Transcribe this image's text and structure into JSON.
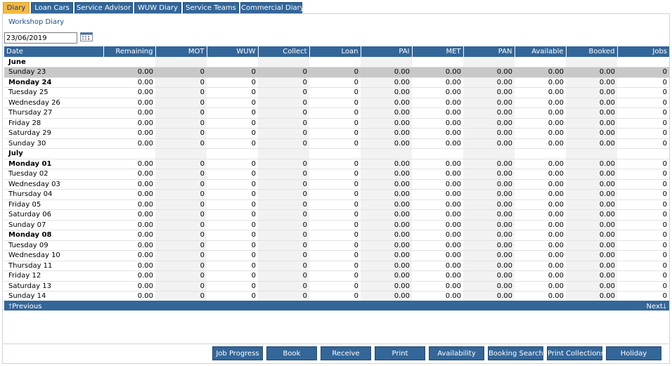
{
  "tabs": [
    {
      "label": "Diary",
      "active": true
    },
    {
      "label": "Loan Cars",
      "active": false
    },
    {
      "label": "Service Advisor",
      "active": false
    },
    {
      "label": "WUW Diary",
      "active": false
    },
    {
      "label": "Service Teams",
      "active": false
    },
    {
      "label": "Commercial Diary",
      "active": false
    }
  ],
  "page_title": "Workshop Diary",
  "date_input": {
    "value": "23/06/2019"
  },
  "columns": [
    "Date",
    "Remaining",
    "MOT",
    "WUW",
    "Collect",
    "Loan",
    "PAI",
    "MET",
    "PAN",
    "Available",
    "Booked",
    "Jobs"
  ],
  "rows": [
    {
      "kind": "month",
      "label": "June"
    },
    {
      "kind": "day",
      "label": "Sunday 23",
      "selected": true,
      "values": [
        "0.00",
        "0",
        "0",
        "0",
        "0",
        "0.00",
        "0.00",
        "0.00",
        "0.00",
        "0.00",
        "0"
      ]
    },
    {
      "kind": "day",
      "label": "Monday 24",
      "bold": true,
      "values": [
        "0.00",
        "0",
        "0",
        "0",
        "0",
        "0.00",
        "0.00",
        "0.00",
        "0.00",
        "0.00",
        "0"
      ]
    },
    {
      "kind": "day",
      "label": "Tuesday 25",
      "values": [
        "0.00",
        "0",
        "0",
        "0",
        "0",
        "0.00",
        "0.00",
        "0.00",
        "0.00",
        "0.00",
        "0"
      ]
    },
    {
      "kind": "day",
      "label": "Wednesday 26",
      "values": [
        "0.00",
        "0",
        "0",
        "0",
        "0",
        "0.00",
        "0.00",
        "0.00",
        "0.00",
        "0.00",
        "0"
      ]
    },
    {
      "kind": "day",
      "label": "Thursday 27",
      "values": [
        "0.00",
        "0",
        "0",
        "0",
        "0",
        "0.00",
        "0.00",
        "0.00",
        "0.00",
        "0.00",
        "0"
      ]
    },
    {
      "kind": "day",
      "label": "Friday 28",
      "values": [
        "0.00",
        "0",
        "0",
        "0",
        "0",
        "0.00",
        "0.00",
        "0.00",
        "0.00",
        "0.00",
        "0"
      ]
    },
    {
      "kind": "day",
      "label": "Saturday 29",
      "values": [
        "0.00",
        "0",
        "0",
        "0",
        "0",
        "0.00",
        "0.00",
        "0.00",
        "0.00",
        "0.00",
        "0"
      ]
    },
    {
      "kind": "day",
      "label": "Sunday 30",
      "values": [
        "0.00",
        "0",
        "0",
        "0",
        "0",
        "0.00",
        "0.00",
        "0.00",
        "0.00",
        "0.00",
        "0"
      ]
    },
    {
      "kind": "month",
      "label": "July"
    },
    {
      "kind": "day",
      "label": "Monday 01",
      "bold": true,
      "values": [
        "0.00",
        "0",
        "0",
        "0",
        "0",
        "0.00",
        "0.00",
        "0.00",
        "0.00",
        "0.00",
        "0"
      ]
    },
    {
      "kind": "day",
      "label": "Tuesday 02",
      "values": [
        "0.00",
        "0",
        "0",
        "0",
        "0",
        "0.00",
        "0.00",
        "0.00",
        "0.00",
        "0.00",
        "0"
      ]
    },
    {
      "kind": "day",
      "label": "Wednesday 03",
      "values": [
        "0.00",
        "0",
        "0",
        "0",
        "0",
        "0.00",
        "0.00",
        "0.00",
        "0.00",
        "0.00",
        "0"
      ]
    },
    {
      "kind": "day",
      "label": "Thursday 04",
      "values": [
        "0.00",
        "0",
        "0",
        "0",
        "0",
        "0.00",
        "0.00",
        "0.00",
        "0.00",
        "0.00",
        "0"
      ]
    },
    {
      "kind": "day",
      "label": "Friday 05",
      "values": [
        "0.00",
        "0",
        "0",
        "0",
        "0",
        "0.00",
        "0.00",
        "0.00",
        "0.00",
        "0.00",
        "0"
      ]
    },
    {
      "kind": "day",
      "label": "Saturday 06",
      "values": [
        "0.00",
        "0",
        "0",
        "0",
        "0",
        "0.00",
        "0.00",
        "0.00",
        "0.00",
        "0.00",
        "0"
      ]
    },
    {
      "kind": "day",
      "label": "Sunday 07",
      "values": [
        "0.00",
        "0",
        "0",
        "0",
        "0",
        "0.00",
        "0.00",
        "0.00",
        "0.00",
        "0.00",
        "0"
      ]
    },
    {
      "kind": "day",
      "label": "Monday 08",
      "bold": true,
      "values": [
        "0.00",
        "0",
        "0",
        "0",
        "0",
        "0.00",
        "0.00",
        "0.00",
        "0.00",
        "0.00",
        "0"
      ]
    },
    {
      "kind": "day",
      "label": "Tuesday 09",
      "values": [
        "0.00",
        "0",
        "0",
        "0",
        "0",
        "0.00",
        "0.00",
        "0.00",
        "0.00",
        "0.00",
        "0"
      ]
    },
    {
      "kind": "day",
      "label": "Wednesday 10",
      "values": [
        "0.00",
        "0",
        "0",
        "0",
        "0",
        "0.00",
        "0.00",
        "0.00",
        "0.00",
        "0.00",
        "0"
      ]
    },
    {
      "kind": "day",
      "label": "Thursday 11",
      "values": [
        "0.00",
        "0",
        "0",
        "0",
        "0",
        "0.00",
        "0.00",
        "0.00",
        "0.00",
        "0.00",
        "0"
      ]
    },
    {
      "kind": "day",
      "label": "Friday 12",
      "values": [
        "0.00",
        "0",
        "0",
        "0",
        "0",
        "0.00",
        "0.00",
        "0.00",
        "0.00",
        "0.00",
        "0"
      ]
    },
    {
      "kind": "day",
      "label": "Saturday 13",
      "values": [
        "0.00",
        "0",
        "0",
        "0",
        "0",
        "0.00",
        "0.00",
        "0.00",
        "0.00",
        "0.00",
        "0"
      ]
    },
    {
      "kind": "day",
      "label": "Sunday 14",
      "values": [
        "0.00",
        "0",
        "0",
        "0",
        "0",
        "0.00",
        "0.00",
        "0.00",
        "0.00",
        "0.00",
        "0"
      ]
    }
  ],
  "pager": {
    "previous": "Previous",
    "next": "Next"
  },
  "buttons": [
    "Job Progress",
    "Book",
    "Receive",
    "Print",
    "Availability",
    "Booking Search",
    "Print Collections",
    "Holiday"
  ],
  "colors": {
    "header": "#336699",
    "active_tab": "#f4b942",
    "selected_row": "#c8c8c8",
    "alt_column": "#f2f2f2"
  }
}
